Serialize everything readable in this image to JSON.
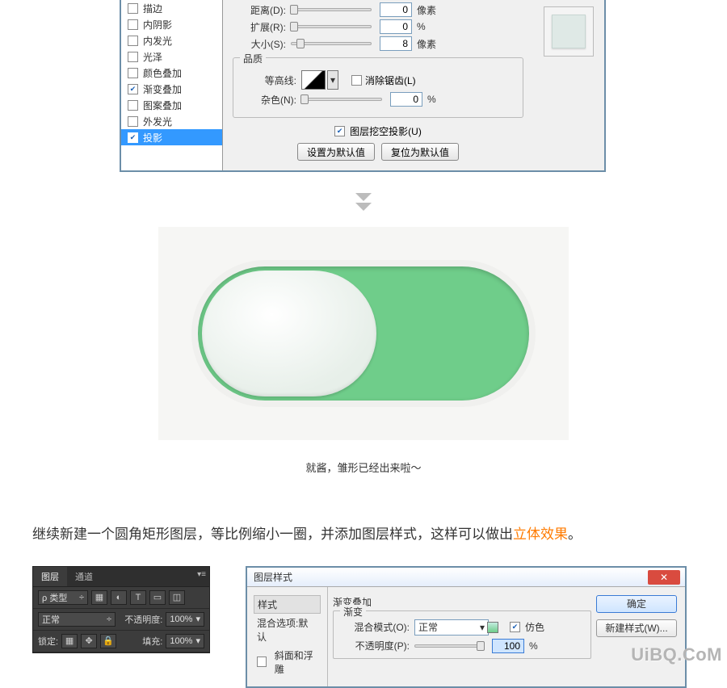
{
  "top_dialog": {
    "styles": [
      {
        "label": "描边",
        "checked": false,
        "selected": false
      },
      {
        "label": "内阴影",
        "checked": false,
        "selected": false
      },
      {
        "label": "内发光",
        "checked": false,
        "selected": false
      },
      {
        "label": "光泽",
        "checked": false,
        "selected": false
      },
      {
        "label": "颜色叠加",
        "checked": false,
        "selected": false
      },
      {
        "label": "渐变叠加",
        "checked": true,
        "selected": false
      },
      {
        "label": "图案叠加",
        "checked": false,
        "selected": false
      },
      {
        "label": "外发光",
        "checked": false,
        "selected": false
      },
      {
        "label": "投影",
        "checked": true,
        "selected": true
      }
    ],
    "structure": {
      "distance_label": "距离(D):",
      "distance_val": "0",
      "distance_unit": "像素",
      "spread_label": "扩展(R):",
      "spread_val": "0",
      "spread_unit": "%",
      "size_label": "大小(S):",
      "size_val": "8",
      "size_unit": "像素"
    },
    "quality": {
      "group_title": "品质",
      "contour_label": "等高线:",
      "antialias_label": "消除锯齿(L)",
      "noise_label": "杂色(N):",
      "noise_val": "0",
      "noise_unit": "%"
    },
    "knock_label": "图层挖空投影(U)",
    "btn_default": "设置为默认值",
    "btn_reset": "复位为默认值"
  },
  "caption": "就酱，雏形已经出来啦～",
  "article": {
    "pre": "继续新建一个圆角矩形图层，等比例缩小一圈，并添加图层样式，这样可以做出",
    "hl": "立体效果",
    "post": "。"
  },
  "layers_panel": {
    "tab_layers": "图层",
    "tab_channels": "通道",
    "kind_label": "ρ 类型",
    "kind_arrow": "÷",
    "blend": "正常",
    "opacity_label": "不透明度:",
    "opacity_val": "100%",
    "lock_label": "锁定:",
    "fill_label": "填充:",
    "fill_val": "100%"
  },
  "bottom_dialog": {
    "title": "图层样式",
    "styles_header": "样式",
    "default_option": "混合选项:默认",
    "bevel": "斜面和浮雕",
    "grad_overlay_title": "渐变叠加",
    "grad_sub": "渐变",
    "blend_label": "混合模式(O):",
    "blend_val": "正常",
    "dither": "仿色",
    "opacity_label": "不透明度(P):",
    "opacity_val": "100",
    "opacity_unit": "%",
    "ok": "确定",
    "new_style": "新建样式(W)..."
  },
  "watermark": "UiBQ.CoM"
}
